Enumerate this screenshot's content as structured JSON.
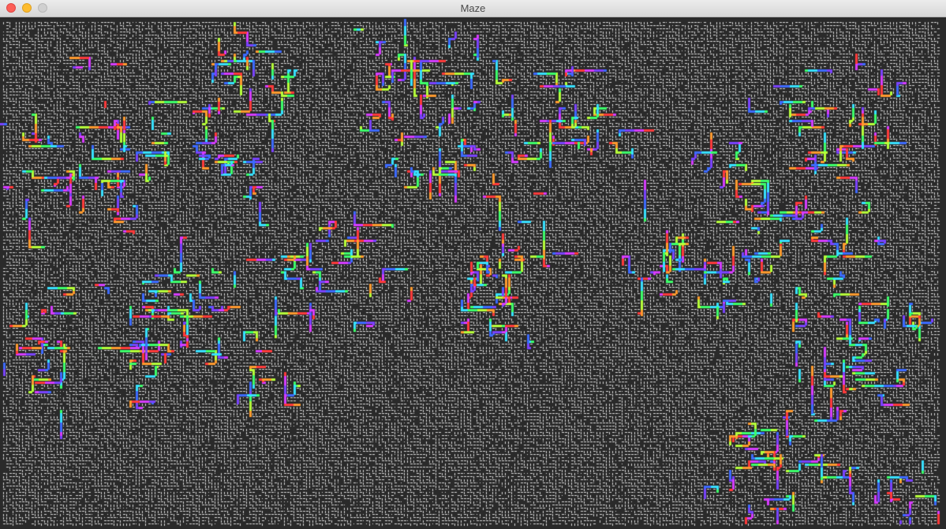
{
  "window": {
    "title": "Maze"
  },
  "maze": {
    "background_color": "#2a2a2a",
    "wall_color": "#d8d8d8",
    "path_palette": [
      "#ff3b3b",
      "#ff9a2e",
      "#b6ff3a",
      "#3dff6a",
      "#38e0ff",
      "#3d6bff",
      "#7a43ff",
      "#d63dff"
    ],
    "solved_regions_visible": true
  },
  "icons": {
    "close": "close-traffic-light",
    "minimize": "minimize-traffic-light",
    "zoom": "zoom-traffic-light"
  }
}
